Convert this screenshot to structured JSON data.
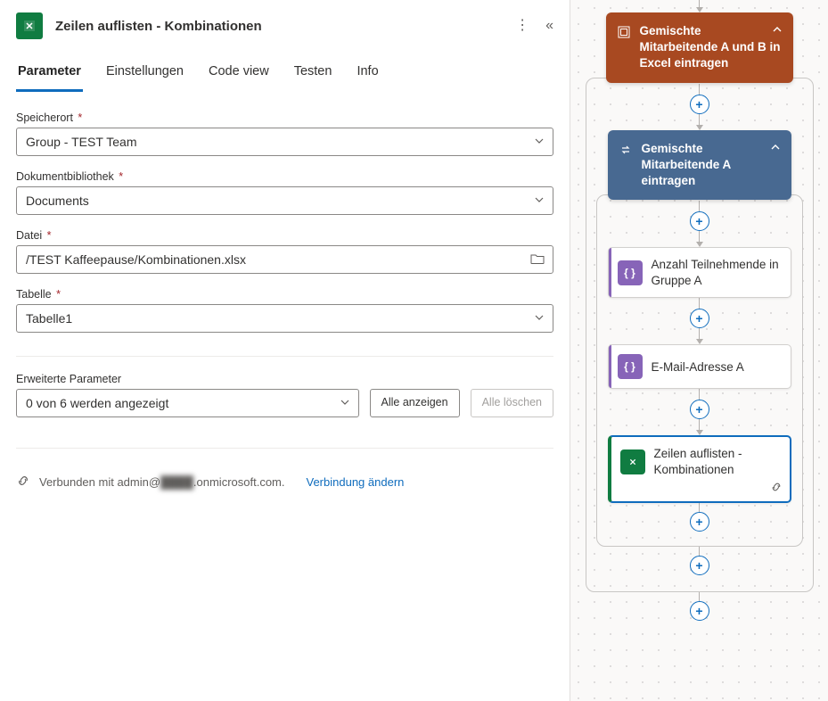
{
  "header": {
    "title": "Zeilen auflisten - Kombinationen"
  },
  "tabs": {
    "parameter": "Parameter",
    "settings": "Einstellungen",
    "codeview": "Code view",
    "testen": "Testen",
    "info": "Info"
  },
  "fields": {
    "location_label": "Speicherort",
    "location_value": "Group - TEST Team",
    "doclib_label": "Dokumentbibliothek",
    "doclib_value": "Documents",
    "file_label": "Datei",
    "file_value": "/TEST Kaffeepause/Kombinationen.xlsx",
    "table_label": "Tabelle",
    "table_value": "Tabelle1"
  },
  "advanced": {
    "label": "Erweiterte Parameter",
    "value": "0 von 6 werden angezeigt",
    "show_all": "Alle anzeigen",
    "clear_all": "Alle löschen"
  },
  "connection": {
    "text_prefix": "Verbunden mit admin@",
    "text_blur": "████",
    "text_suffix": ".onmicrosoft.com.",
    "change_link": "Verbindung ändern"
  },
  "flow": {
    "outer_scope": "Gemischte Mitarbeitende A und B in Excel eintragen",
    "inner_scope": "Gemischte Mitarbeitende A eintragen",
    "action1": "Anzahl Teilnehmende in Gruppe A",
    "action2": "E-Mail-Adresse A",
    "action3": "Zeilen auflisten - Kombinationen"
  }
}
